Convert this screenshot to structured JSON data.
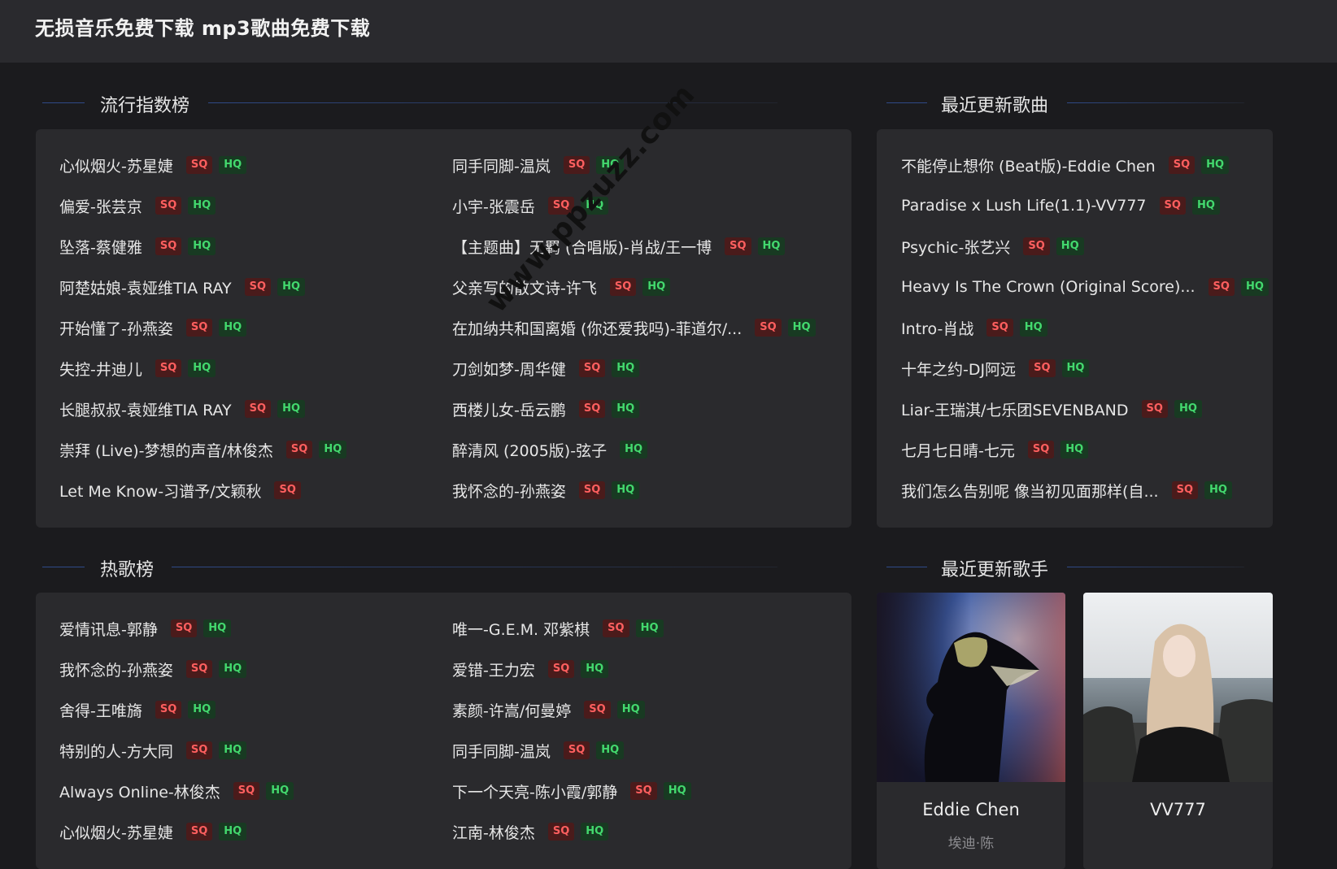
{
  "site_title": "无损音乐免费下载 mp3歌曲免费下载",
  "badges": {
    "sq": "SQ",
    "hq": "HQ"
  },
  "watermark": "www.ppzuzz.com",
  "popular": {
    "title": "流行指数榜",
    "left": [
      {
        "name": "心似烟火-苏星婕",
        "sq": true,
        "hq": true
      },
      {
        "name": "偏爱-张芸京",
        "sq": true,
        "hq": true
      },
      {
        "name": "坠落-蔡健雅",
        "sq": true,
        "hq": true
      },
      {
        "name": "阿楚姑娘-袁娅维TIA RAY",
        "sq": true,
        "hq": true
      },
      {
        "name": "开始懂了-孙燕姿",
        "sq": true,
        "hq": true
      },
      {
        "name": "失控-井迪儿",
        "sq": true,
        "hq": true
      },
      {
        "name": "长腿叔叔-袁娅维TIA RAY",
        "sq": true,
        "hq": true
      },
      {
        "name": "崇拜 (Live)-梦想的声音/林俊杰",
        "sq": true,
        "hq": true
      },
      {
        "name": "Let Me Know-习谱予/文颖秋",
        "sq": true,
        "hq": false
      }
    ],
    "right": [
      {
        "name": "同手同脚-温岚",
        "sq": true,
        "hq": true
      },
      {
        "name": "小宇-张震岳",
        "sq": true,
        "hq": true
      },
      {
        "name": "【主题曲】无羁 (合唱版)-肖战/王一博",
        "sq": true,
        "hq": true
      },
      {
        "name": "父亲写的散文诗-许飞",
        "sq": true,
        "hq": true
      },
      {
        "name": "在加纳共和国离婚 (你还爱我吗)-菲道尔/...",
        "sq": true,
        "hq": true
      },
      {
        "name": "刀剑如梦-周华健",
        "sq": true,
        "hq": true
      },
      {
        "name": "西楼儿女-岳云鹏",
        "sq": true,
        "hq": true
      },
      {
        "name": "醉清风 (2005版)-弦子",
        "sq": false,
        "hq": true
      },
      {
        "name": "我怀念的-孙燕姿",
        "sq": true,
        "hq": true
      }
    ]
  },
  "recent_songs": {
    "title": "最近更新歌曲",
    "items": [
      {
        "name": "不能停止想你 (Beat版)-Eddie Chen",
        "sq": true,
        "hq": true
      },
      {
        "name": "Paradise x Lush Life(1.1)-VV777",
        "sq": true,
        "hq": true
      },
      {
        "name": "Psychic-张艺兴",
        "sq": true,
        "hq": true
      },
      {
        "name": "Heavy Is The Crown (Original Score)...",
        "sq": true,
        "hq": true
      },
      {
        "name": "Intro-肖战",
        "sq": true,
        "hq": true
      },
      {
        "name": "十年之约-DJ阿远",
        "sq": true,
        "hq": true
      },
      {
        "name": "Liar-王瑞淇/七乐团SEVENBAND",
        "sq": true,
        "hq": true
      },
      {
        "name": "七月七日晴-七元",
        "sq": true,
        "hq": true
      },
      {
        "name": "我们怎么告别呢 像当初见面那样(自...",
        "sq": true,
        "hq": true
      }
    ]
  },
  "hot": {
    "title": "热歌榜",
    "left": [
      {
        "name": "爱情讯息-郭静",
        "sq": true,
        "hq": true
      },
      {
        "name": "我怀念的-孙燕姿",
        "sq": true,
        "hq": true
      },
      {
        "name": "舍得-王唯旖",
        "sq": true,
        "hq": true
      },
      {
        "name": "特别的人-方大同",
        "sq": true,
        "hq": true
      },
      {
        "name": "Always Online-林俊杰",
        "sq": true,
        "hq": true
      },
      {
        "name": "心似烟火-苏星婕",
        "sq": true,
        "hq": true
      }
    ],
    "right": [
      {
        "name": "唯一-G.E.M. 邓紫棋",
        "sq": true,
        "hq": true
      },
      {
        "name": "爱错-王力宏",
        "sq": true,
        "hq": true
      },
      {
        "name": "素颜-许嵩/何曼婷",
        "sq": true,
        "hq": true
      },
      {
        "name": "同手同脚-温岚",
        "sq": true,
        "hq": true
      },
      {
        "name": "下一个天亮-陈小霞/郭静",
        "sq": true,
        "hq": true
      },
      {
        "name": "江南-林俊杰",
        "sq": true,
        "hq": true
      }
    ]
  },
  "recent_artists": {
    "title": "最近更新歌手",
    "items": [
      {
        "name": "Eddie Chen",
        "alias": "埃迪·陈"
      },
      {
        "name": "VV777",
        "alias": ""
      }
    ]
  }
}
